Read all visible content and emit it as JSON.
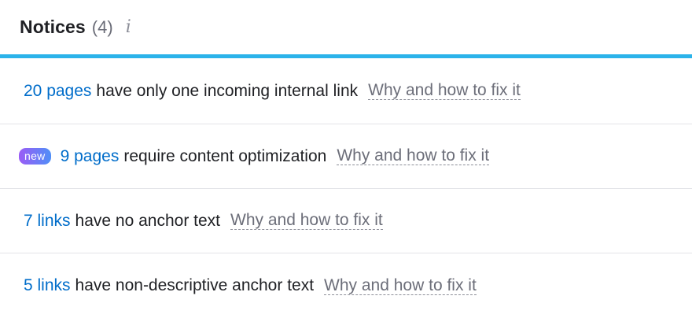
{
  "header": {
    "title": "Notices",
    "count": "(4)",
    "info_icon": "info-icon"
  },
  "colors": {
    "accent": "#2bb3ea",
    "link": "#006dca",
    "badge_gradient": [
      "#9b5cf6",
      "#4f8ff7"
    ]
  },
  "notices": [
    {
      "badge": "",
      "link_text": "20 pages",
      "description": "have only one incoming internal link",
      "help_text": "Why and how to fix it"
    },
    {
      "badge": "new",
      "link_text": "9 pages",
      "description": "require content optimization",
      "help_text": "Why and how to fix it"
    },
    {
      "badge": "",
      "link_text": "7 links",
      "description": "have no anchor text",
      "help_text": "Why and how to fix it"
    },
    {
      "badge": "",
      "link_text": "5 links",
      "description": "have non-descriptive anchor text",
      "help_text": "Why and how to fix it"
    }
  ]
}
